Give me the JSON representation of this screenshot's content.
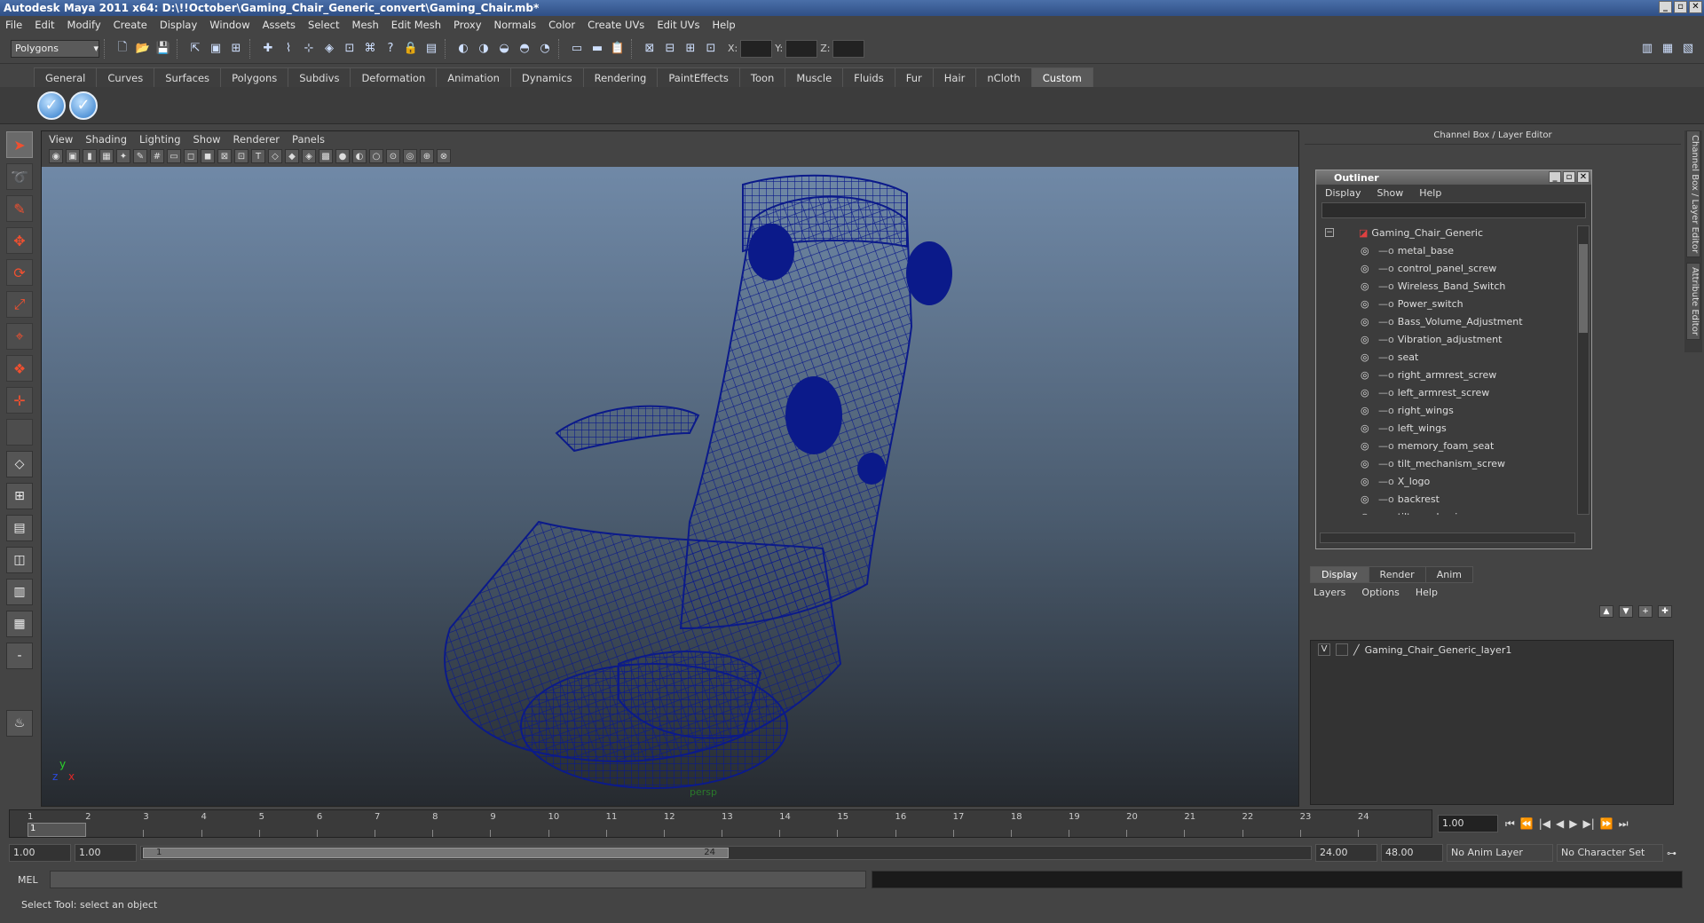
{
  "window": {
    "title": "Autodesk Maya 2011 x64: D:\\!!October\\Gaming_Chair_Generic_convert\\Gaming_Chair.mb*"
  },
  "menubar": [
    "File",
    "Edit",
    "Modify",
    "Create",
    "Display",
    "Window",
    "Assets",
    "Select",
    "Mesh",
    "Edit Mesh",
    "Proxy",
    "Normals",
    "Color",
    "Create UVs",
    "Edit UVs",
    "Help"
  ],
  "statusline": {
    "mode": "Polygons",
    "x_label": "X:",
    "y_label": "Y:",
    "z_label": "Z:"
  },
  "shelf_tabs": [
    "General",
    "Curves",
    "Surfaces",
    "Polygons",
    "Subdivs",
    "Deformation",
    "Animation",
    "Dynamics",
    "Rendering",
    "PaintEffects",
    "Toon",
    "Muscle",
    "Fluids",
    "Fur",
    "Hair",
    "nCloth",
    "Custom"
  ],
  "shelf_active": "Custom",
  "viewport": {
    "menu": [
      "View",
      "Shading",
      "Lighting",
      "Show",
      "Renderer",
      "Panels"
    ],
    "camera_label": "persp",
    "axis": {
      "x": "x",
      "y": "y",
      "z": "z"
    },
    "wire_color": "#0b1a8a"
  },
  "right_panel": {
    "header": "Channel Box / Layer Editor"
  },
  "outliner": {
    "title": "Outliner",
    "menu": [
      "Display",
      "Show",
      "Help"
    ],
    "root": "Gaming_Chair_Generic",
    "items": [
      "metal_base",
      "control_panel_screw",
      "Wireless_Band_Switch",
      "Power_switch",
      "Bass_Volume_Adjustment",
      "Vibration_adjustment",
      "seat",
      "right_armrest_screw",
      "left_armrest_screw",
      "right_wings",
      "left_wings",
      "memory_foam_seat",
      "tilt_mechanism_screw",
      "X_logo",
      "backrest",
      "tilt_mechanism"
    ]
  },
  "layer_editor": {
    "tabs": [
      "Display",
      "Render",
      "Anim"
    ],
    "menu": [
      "Layers",
      "Options",
      "Help"
    ],
    "layers": [
      {
        "v": "V",
        "name": "Gaming_Chair_Generic_layer1"
      }
    ]
  },
  "side_tabs": [
    "Channel Box / Layer Editor",
    "Attribute Editor"
  ],
  "timeline": {
    "ticks": [
      "1",
      "2",
      "3",
      "4",
      "5",
      "6",
      "7",
      "8",
      "9",
      "10",
      "11",
      "12",
      "13",
      "14",
      "15",
      "16",
      "17",
      "18",
      "19",
      "20",
      "21",
      "22",
      "23",
      "24"
    ],
    "current_frame": "1.00",
    "current_marker": "1"
  },
  "range": {
    "start": "1.00",
    "playback_start": "1.00",
    "slider_start": "1",
    "slider_end": "24",
    "playback_end": "24.00",
    "end": "48.00",
    "anim_layer": "No Anim Layer",
    "char_set": "No Character Set"
  },
  "command": {
    "label": "MEL"
  },
  "help_line": "Select Tool: select an object"
}
